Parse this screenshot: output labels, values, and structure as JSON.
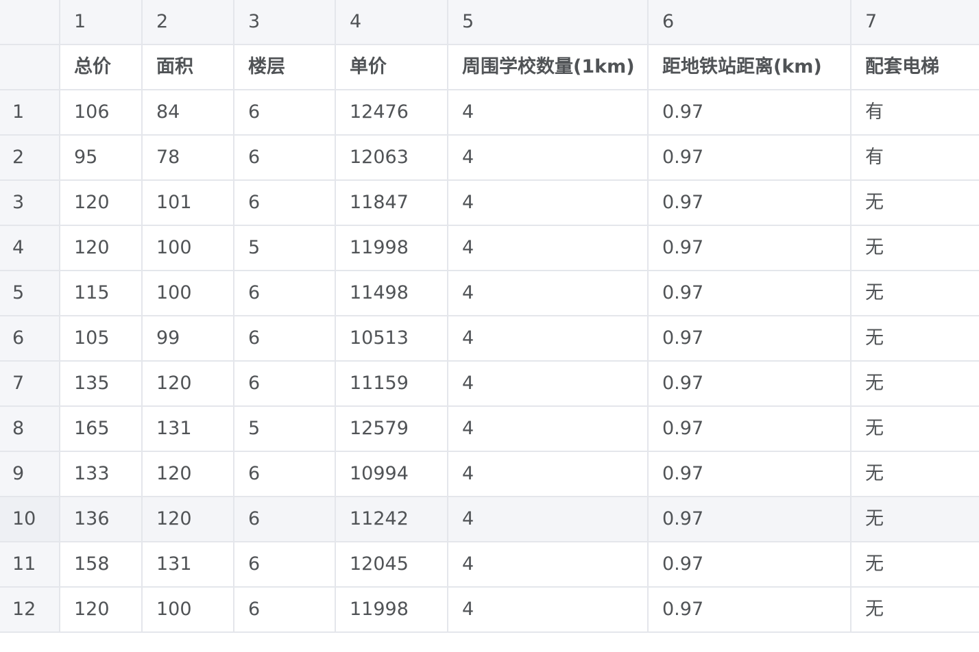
{
  "column_numbers": [
    "1",
    "2",
    "3",
    "4",
    "5",
    "6",
    "7"
  ],
  "field_names": [
    "总价",
    "面积",
    "楼层",
    "单价",
    "周围学校数量(1km)",
    "距地铁站距离(km)",
    "配套电梯"
  ],
  "rows": [
    {
      "index": "1",
      "cells": [
        "106",
        "84",
        "6",
        "12476",
        "4",
        "0.97",
        "有"
      ]
    },
    {
      "index": "2",
      "cells": [
        "95",
        "78",
        "6",
        "12063",
        "4",
        "0.97",
        "有"
      ]
    },
    {
      "index": "3",
      "cells": [
        "120",
        "101",
        "6",
        "11847",
        "4",
        "0.97",
        "无"
      ]
    },
    {
      "index": "4",
      "cells": [
        "120",
        "100",
        "5",
        "11998",
        "4",
        "0.97",
        "无"
      ]
    },
    {
      "index": "5",
      "cells": [
        "115",
        "100",
        "6",
        "11498",
        "4",
        "0.97",
        "无"
      ]
    },
    {
      "index": "6",
      "cells": [
        "105",
        "99",
        "6",
        "10513",
        "4",
        "0.97",
        "无"
      ]
    },
    {
      "index": "7",
      "cells": [
        "135",
        "120",
        "6",
        "11159",
        "4",
        "0.97",
        "无"
      ]
    },
    {
      "index": "8",
      "cells": [
        "165",
        "131",
        "5",
        "12579",
        "4",
        "0.97",
        "无"
      ]
    },
    {
      "index": "9",
      "cells": [
        "133",
        "120",
        "6",
        "10994",
        "4",
        "0.97",
        "无"
      ]
    },
    {
      "index": "10",
      "cells": [
        "136",
        "120",
        "6",
        "11242",
        "4",
        "0.97",
        "无"
      ]
    },
    {
      "index": "11",
      "cells": [
        "158",
        "131",
        "6",
        "12045",
        "4",
        "0.97",
        "无"
      ]
    },
    {
      "index": "12",
      "cells": [
        "120",
        "100",
        "6",
        "11998",
        "4",
        "0.97",
        "无"
      ]
    }
  ],
  "highlighted_row": "10",
  "colors": {
    "header_background": "#f5f6f9",
    "grid_line": "#e4e6eb",
    "text": "#505356",
    "highlight_row": "#f4f5f8"
  }
}
